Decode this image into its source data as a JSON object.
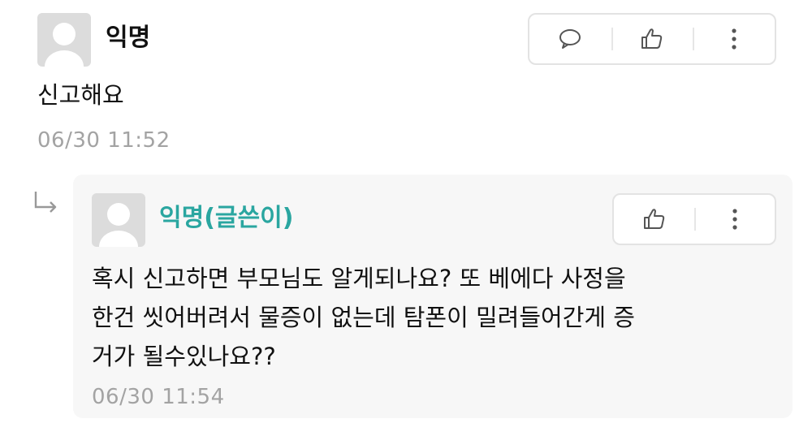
{
  "comment": {
    "author": "익명",
    "text": "신고해요",
    "timestamp": "06/30 11:52",
    "actions": [
      "comment-icon",
      "thumbs-up-icon",
      "more-vertical-icon"
    ]
  },
  "reply": {
    "author": "익명(글쓴이)",
    "author_color": "#2aa6a0",
    "lines": [
      "혹시 신고하면 부모님도 알게되나요? 또 베에다 사정을",
      "한건 씻어버려서 물증이 없는데 탐폰이 밀려들어간게 증",
      "거가 될수있나요??"
    ],
    "timestamp": "06/30 11:54",
    "actions": [
      "thumbs-up-icon",
      "more-vertical-icon"
    ]
  }
}
